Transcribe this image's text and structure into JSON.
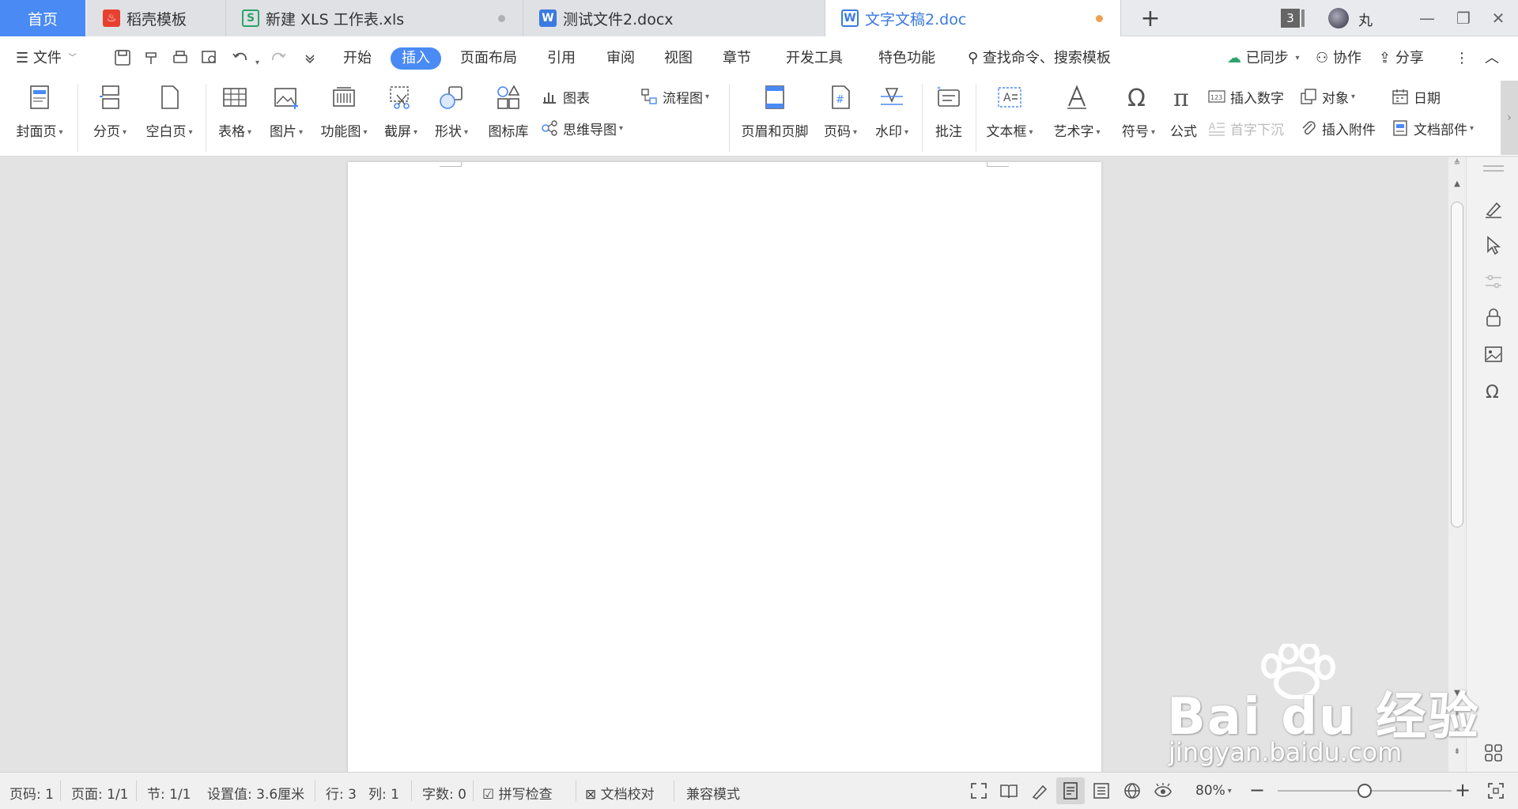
{
  "tabs": {
    "home": "首页",
    "templates": "稻壳模板",
    "xls": "新建 XLS 工作表.xls",
    "docx": "测试文件2.docx",
    "doc": "文字文稿2.doc",
    "tab_count": "3",
    "user": "丸"
  },
  "menu": {
    "file": "文件",
    "start": "开始",
    "insert": "插入",
    "layout": "页面布局",
    "references": "引用",
    "review": "审阅",
    "view": "视图",
    "chapter": "章节",
    "dev": "开发工具",
    "special": "特色功能",
    "search": "查找命令、搜索模板",
    "synced": "已同步",
    "collab": "协作",
    "share": "分享"
  },
  "ribbon": {
    "cover": "封面页",
    "page_break": "分页",
    "blank_page": "空白页",
    "table": "表格",
    "picture": "图片",
    "function_chart": "功能图",
    "screenshot": "截屏",
    "shape": "形状",
    "icon_lib": "图标库",
    "chart": "图表",
    "mindmap": "思维导图",
    "flowchart": "流程图",
    "header_footer": "页眉和页脚",
    "page_number": "页码",
    "watermark": "水印",
    "comment": "批注",
    "textbox": "文本框",
    "wordart": "艺术字",
    "symbol": "符号",
    "formula": "公式",
    "insert_number": "插入数字",
    "drop_cap": "首字下沉",
    "object": "对象",
    "attachment": "插入附件",
    "date": "日期",
    "doc_parts": "文档部件"
  },
  "status": {
    "page_num": "页码: 1",
    "pages": "页面: 1/1",
    "section": "节: 1/1",
    "setting": "设置值: 3.6厘米",
    "row": "行: 3",
    "col": "列: 1",
    "words": "字数: 0",
    "spell": "拼写检查",
    "proof": "文档校对",
    "compat": "兼容模式",
    "zoom": "80%"
  },
  "zoom_level": 0.5,
  "watermark": {
    "main": "Bai du 经验",
    "sub": "jingyan.baidu.com"
  },
  "colors": {
    "accent": "#4a8af4",
    "active_tab_dot": "#f0a050"
  }
}
